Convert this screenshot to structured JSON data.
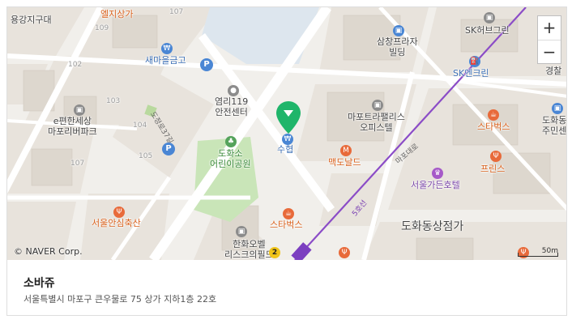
{
  "map": {
    "copyright": "© NAVER Corp.",
    "scale_label": "50m",
    "zoom_in": "+",
    "zoom_out": "−",
    "labels": {
      "yonggang": "용강지구대",
      "elji": "엘지상가",
      "n107a": "107",
      "n109": "109",
      "n102": "102",
      "n103": "103",
      "n104": "104",
      "n105": "105",
      "n107b": "107",
      "saemaeul": "새마을금고",
      "yeomri": "염리119\n안전센터",
      "ehyeonsesang": "e편한세상\n마포리버파크",
      "dohwaso": "도화소\n어린이공원",
      "seoulan": "서울안심축산",
      "hanhwa": "한화오벨\n리스크의필드",
      "samchang": "삼창프라자\n빌딩",
      "skhub": "SK허브그린",
      "skenc": "SK엔크린",
      "mapotrapalace": "마포트라팰리스\n오피스텔",
      "suhyup": "수협",
      "mcdonalds": "맥도날드",
      "starbucks1": "스타벅스",
      "starbucks2": "스타벅스",
      "seoulgarden": "서울가든호텔",
      "dohwadongsangga": "도화동상점가",
      "prince": "프린스",
      "dohwadongoffice": "도화동\n주민센",
      "police": "경찰",
      "road_dojeong": "도정로37길",
      "road_mapodaero": "마포대로",
      "line5": "5호선",
      "subway_badge": "2"
    }
  },
  "place": {
    "name": "소바쥬",
    "address": "서울특별시 마포구 큰우물로 75 상가 지하1층 22호"
  },
  "colors": {
    "park": "#c9e5b8",
    "block": "#e7e2db",
    "building": "#dcd6cd",
    "road": "#ffffff",
    "line5": "#8b4cc7",
    "marker": "#1fb56a"
  }
}
